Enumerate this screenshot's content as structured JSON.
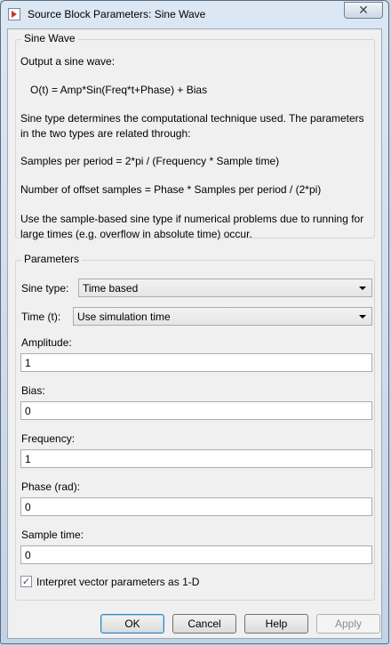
{
  "window": {
    "title": "Source Block Parameters: Sine Wave",
    "close_glyph": "✕"
  },
  "block_group": {
    "title": "Sine Wave",
    "lines": [
      "Output a sine wave:",
      "O(t) = Amp*Sin(Freq*t+Phase) + Bias",
      "Sine type determines the computational technique used. The parameters in the two types are related through:",
      "Samples per period = 2*pi / (Frequency * Sample time)",
      "Number of offset samples = Phase * Samples per period / (2*pi)",
      "Use the sample-based sine type if numerical problems due to running for large times (e.g. overflow in absolute time) occur."
    ]
  },
  "parameters": {
    "title": "Parameters",
    "sine_type": {
      "label": "Sine type:",
      "value": "Time based"
    },
    "time": {
      "label": "Time (t):",
      "value": "Use simulation time"
    },
    "amplitude": {
      "label": "Amplitude:",
      "value": "1"
    },
    "bias": {
      "label": "Bias:",
      "value": "0"
    },
    "frequency": {
      "label": "Frequency:",
      "value": "1"
    },
    "phase": {
      "label": "Phase (rad):",
      "value": "0"
    },
    "sample_time": {
      "label": "Sample time:",
      "value": "0"
    },
    "interpret_vector": {
      "label": "Interpret vector parameters as 1-D",
      "checked": true,
      "check_glyph": "✓"
    }
  },
  "buttons": {
    "ok": "OK",
    "cancel": "Cancel",
    "help": "Help",
    "apply": "Apply"
  }
}
